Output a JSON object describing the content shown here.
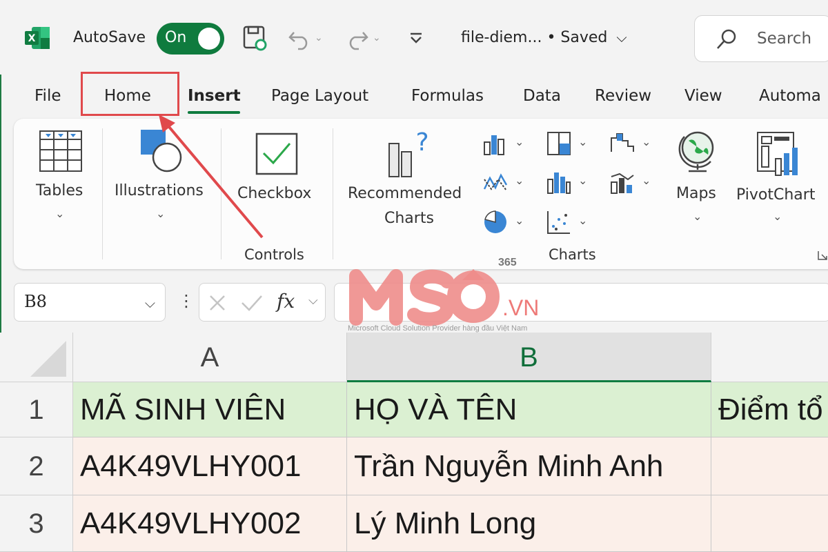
{
  "titlebar": {
    "autosave_label": "AutoSave",
    "autosave_state": "On",
    "filename": "file-diem...  •  Saved",
    "search_placeholder": "Search"
  },
  "tabs": [
    {
      "label": "File"
    },
    {
      "label": "Home"
    },
    {
      "label": "Insert"
    },
    {
      "label": "Page Layout"
    },
    {
      "label": "Formulas"
    },
    {
      "label": "Data"
    },
    {
      "label": "Review"
    },
    {
      "label": "View"
    },
    {
      "label": "Automa"
    }
  ],
  "ribbon": {
    "tables": "Tables",
    "illustrations": "Illustrations",
    "checkbox": "Checkbox",
    "controls_group": "Controls",
    "recommended_line1": "Recommended",
    "recommended_line2": "Charts",
    "charts_group": "Charts",
    "maps": "Maps",
    "pivotchart": "PivotChart"
  },
  "formula_bar": {
    "name_box": "B8",
    "fx": "fx",
    "formula": ""
  },
  "grid": {
    "columns": [
      "A",
      "B"
    ],
    "rows": [
      {
        "num": "1",
        "a": "MÃ SINH VIÊN",
        "b": "HỌ VÀ TÊN",
        "c": "Điểm tổ"
      },
      {
        "num": "2",
        "a": "A4K49VLHY001",
        "b": "Trần Nguyễn Minh Anh",
        "c": ""
      },
      {
        "num": "3",
        "a": "A4K49VLHY002",
        "b": "Lý Minh Long",
        "c": ""
      }
    ]
  },
  "watermark": {
    "brand": "MSO",
    "suffix": ".VN",
    "badge": "365",
    "tagline": "Microsoft Cloud Solution Provider hàng đầu Việt Nam"
  },
  "colors": {
    "accent": "#0f7b3e",
    "header_fill": "#dbf0d2",
    "body_fill": "#fbefe9",
    "highlight": "#e0494c"
  }
}
